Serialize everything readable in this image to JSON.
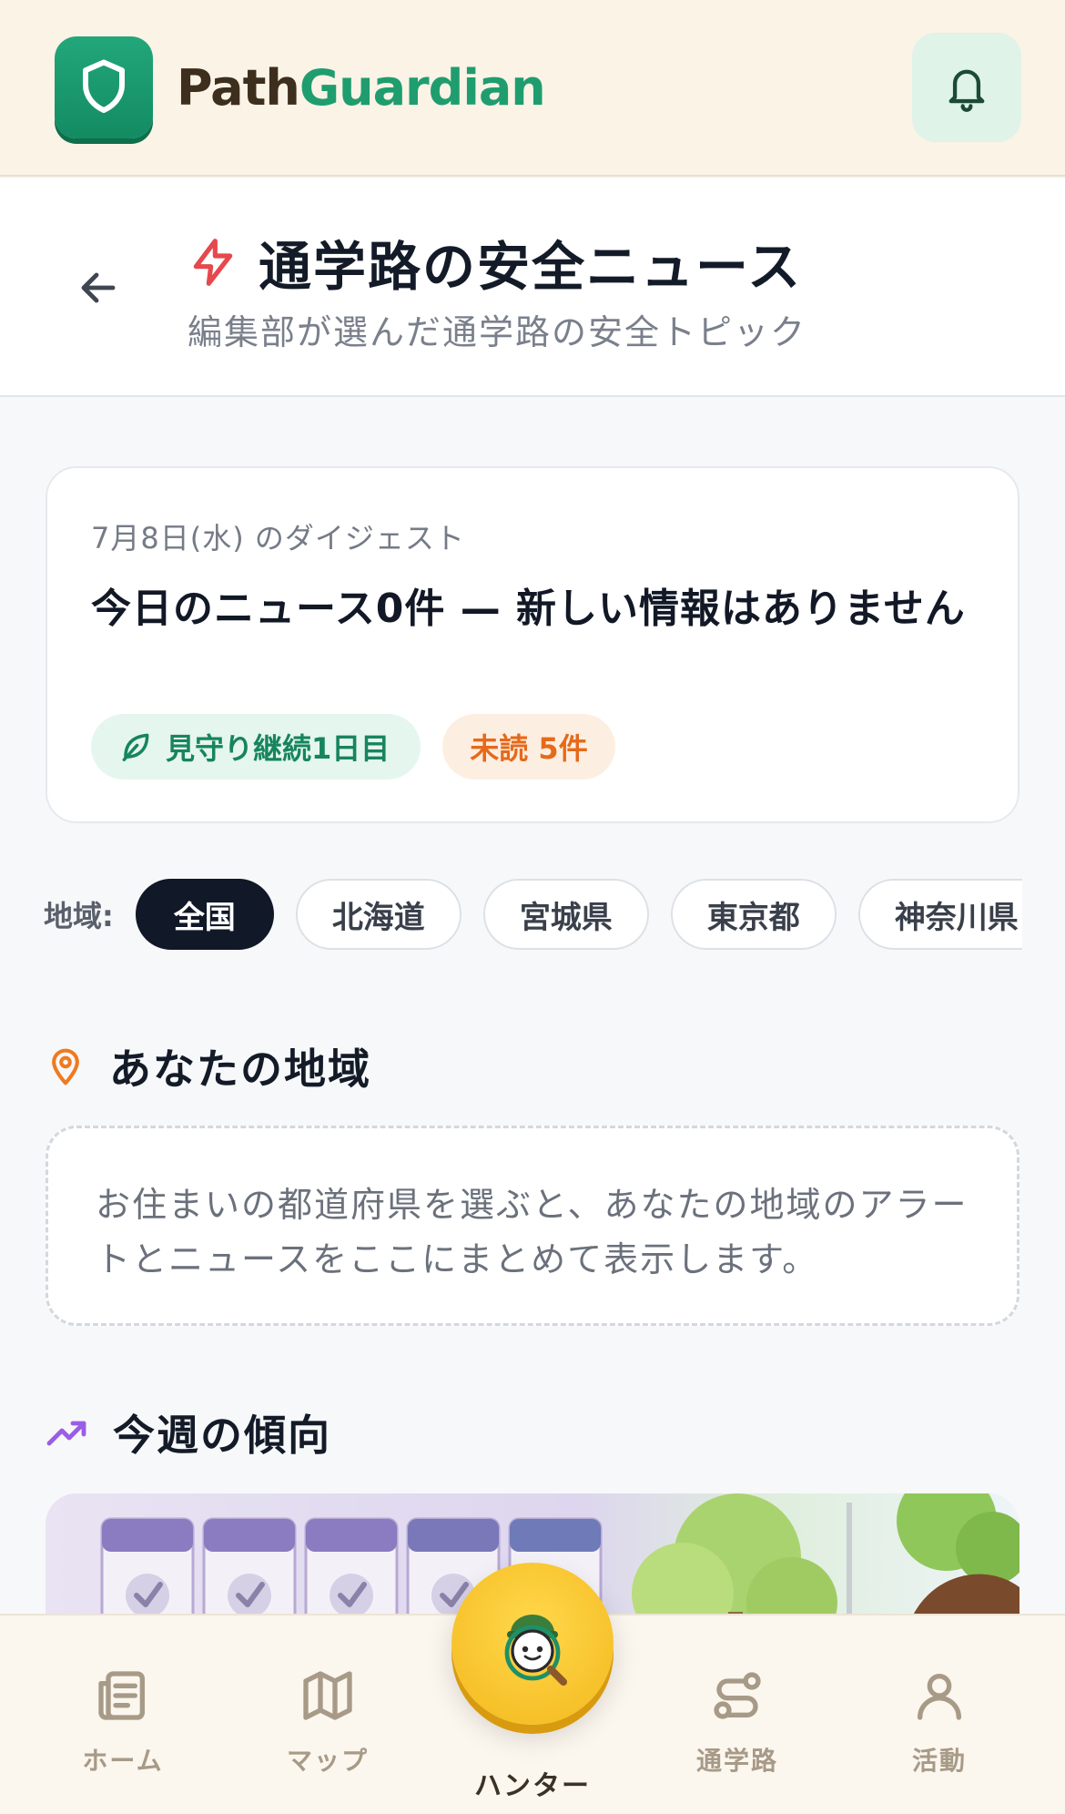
{
  "app": {
    "brand_part1": "Path",
    "brand_part2": "Guardian"
  },
  "page": {
    "title": "通学路の安全ニュース",
    "subtitle": "編集部が選んだ通学路の安全トピック"
  },
  "digest": {
    "date": "7月8日(水) のダイジェスト",
    "headline": "今日のニュース0件 — 新しい情報はありません",
    "streak_chip": "見守り継続1日目",
    "unread_chip": "未読 5件"
  },
  "region_filter": {
    "label": "地域:",
    "options": [
      "全国",
      "北海道",
      "宮城県",
      "東京都",
      "神奈川県"
    ],
    "selected": "全国"
  },
  "your_region": {
    "title": "あなたの地域",
    "message": "お住まいの都道府県を選ぶと、あなたの地域のアラートとニュースをここにまとめて表示します。"
  },
  "weekly_trend": {
    "title": "今週の傾向"
  },
  "bottom_nav": {
    "home": "ホーム",
    "map": "マップ",
    "hunter": "ハンター",
    "route": "通学路",
    "activity": "活動"
  },
  "colors": {
    "brand_green": "#1f9d6e",
    "accent_orange": "#e56a1a",
    "alert_red": "#e5484d",
    "dark": "#111827"
  }
}
